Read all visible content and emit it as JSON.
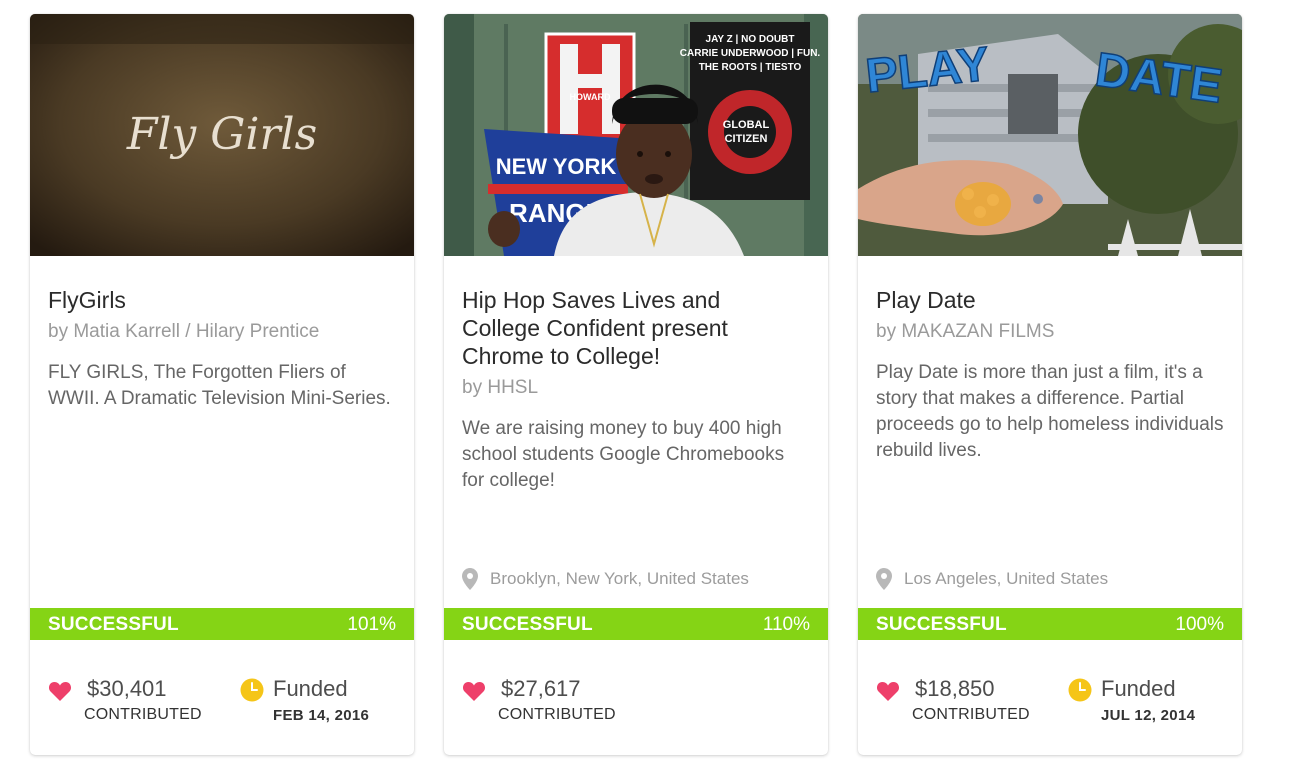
{
  "cards": [
    {
      "thumbnail_text": "Fly Girls",
      "title": "FlyGirls",
      "byline": "by Matia Karrell / Hilary Prentice",
      "description": "FLY GIRLS, The Forgotten Fliers of WWII. A Dramatic Television Mini-Series.",
      "location": "",
      "status": "SUCCESSFUL",
      "percent": "101%",
      "amount": "$30,401",
      "amount_label": "CONTRIBUTED",
      "funded_label": "Funded",
      "funded_date": "FEB 14, 2016"
    },
    {
      "thumbnail_text": "",
      "title": "Hip Hop Saves Lives and College Confident present Chrome to College!",
      "byline": "by HHSL",
      "description": "We are raising money to buy 400 high school students Google Chromebooks for college!",
      "location": "Brooklyn, New York, United States",
      "status": "SUCCESSFUL",
      "percent": "110%",
      "amount": "$27,617",
      "amount_label": "CONTRIBUTED",
      "funded_label": "",
      "funded_date": ""
    },
    {
      "thumbnail_text": "PLAY DATE",
      "title": "Play Date",
      "byline": "by MAKAZAN FILMS",
      "description": "Play Date is more than just a film, it's a story that makes a difference. Partial proceeds go to help homeless individuals rebuild lives.",
      "location": "Los Angeles, United States",
      "status": "SUCCESSFUL",
      "percent": "100%",
      "amount": "$18,850",
      "amount_label": "CONTRIBUTED",
      "funded_label": "Funded",
      "funded_date": "JUL 12, 2014"
    }
  ],
  "thumb_words": {
    "howard": "HOWARD",
    "newyork": "NEW YORK",
    "rangers": "RANGE",
    "poster": [
      "JAY Z | NO DOUBT",
      "CARRIE UNDERWOOD | FUN.",
      "THE ROOTS | TIESTO"
    ],
    "global": "GLOBAL",
    "citizen": "CITIZEN",
    "play": "PLAY",
    "date": "DATE"
  },
  "colors": {
    "status_green": "#85d415",
    "heart": "#ee3f6a",
    "clock": "#f5c518"
  },
  "icons": [
    "location-pin-icon",
    "heart-icon",
    "clock-icon"
  ]
}
